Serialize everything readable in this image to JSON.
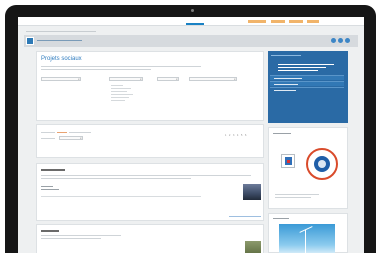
{
  "app": {
    "nav": [
      "",
      "",
      "",
      "",
      ""
    ],
    "breadcrumb": "",
    "section_title": ""
  },
  "main": {
    "title": "Projets sociaux",
    "subtitle": "",
    "filters": {
      "labels": [
        "",
        "",
        "",
        ""
      ],
      "values": [
        "",
        "",
        "",
        ""
      ]
    },
    "options": [
      "",
      "",
      "",
      "",
      "",
      ""
    ],
    "results": {
      "text_before": "",
      "highlight": "",
      "text_after": "",
      "sort_label": "",
      "pages": "1 2 3 4 5 6"
    },
    "article1": {
      "title": "",
      "summary": "",
      "meta_labels": [
        "",
        ""
      ],
      "body": "",
      "more": ""
    },
    "article2": {
      "title": "",
      "summary": ""
    }
  },
  "sidebar": {
    "title": "",
    "heading": "",
    "links": [
      "",
      "",
      ""
    ],
    "partners_title": "",
    "images_title": ""
  },
  "colors": {
    "accent": "#2f7cbf",
    "sidebar": "#2a6aa5",
    "highlight": "#e06a1f"
  }
}
